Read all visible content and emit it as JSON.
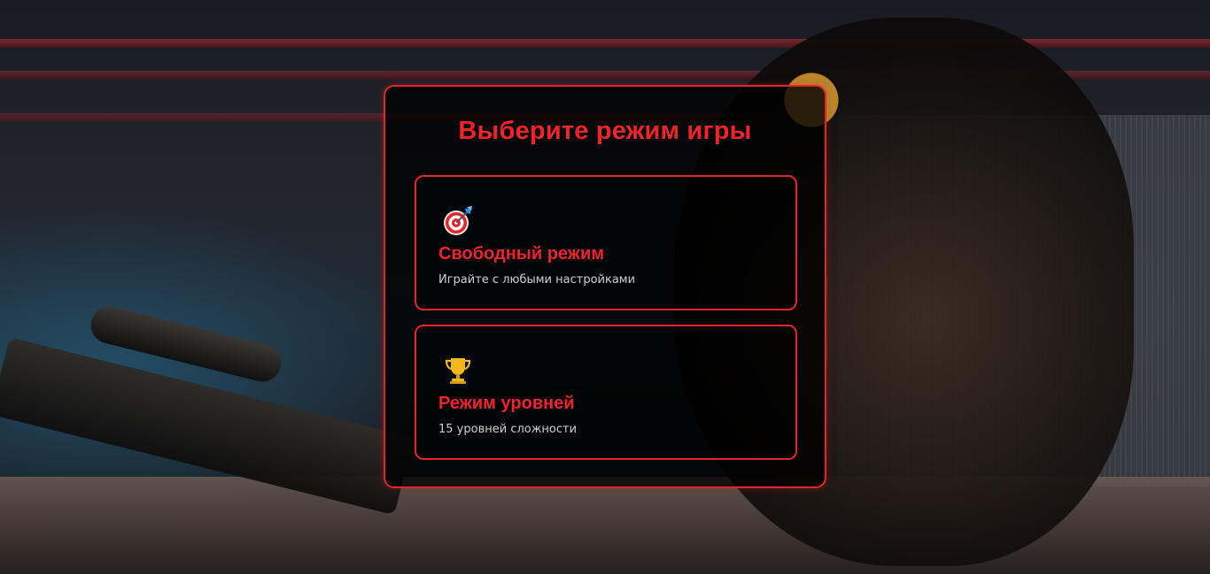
{
  "dialog": {
    "title": "Выберите режим игры",
    "modes": [
      {
        "icon": "target-dart-icon",
        "title": "Свободный режим",
        "description": "Играйте с любыми настройками"
      },
      {
        "icon": "trophy-icon",
        "title": "Режим уровней",
        "description": "15 уровней сложности"
      }
    ]
  },
  "colors": {
    "accent": "#e3242b",
    "title_red": "#f0222b",
    "trophy_gold": "#f2b71c",
    "description_text": "#cfcfcf",
    "panel_background": "rgba(0,0,0,0.78)"
  }
}
